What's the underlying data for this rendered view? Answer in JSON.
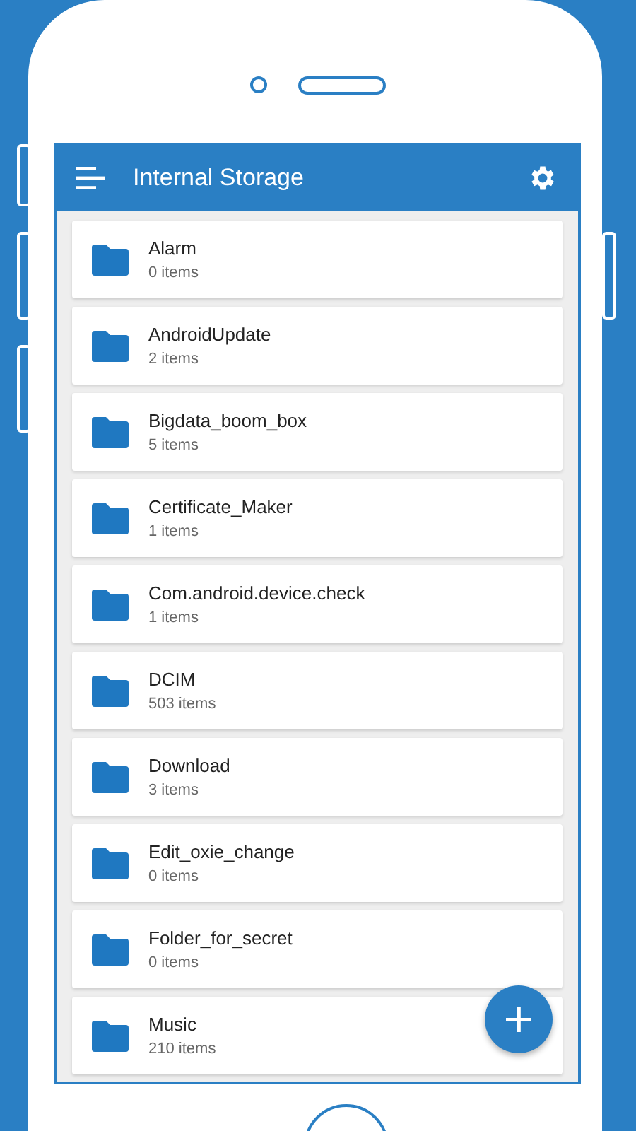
{
  "header": {
    "title": "Internal Storage"
  },
  "folders": [
    {
      "name": "Alarm",
      "count": "0 items"
    },
    {
      "name": "AndroidUpdate",
      "count": "2 items"
    },
    {
      "name": "Bigdata_boom_box",
      "count": "5 items"
    },
    {
      "name": "Certificate_Maker",
      "count": "1 items"
    },
    {
      "name": "Com.android.device.check",
      "count": "1 items"
    },
    {
      "name": "DCIM",
      "count": "503 items"
    },
    {
      "name": "Download",
      "count": "3 items"
    },
    {
      "name": "Edit_oxie_change",
      "count": "0 items"
    },
    {
      "name": "Folder_for_secret",
      "count": "0 items"
    },
    {
      "name": "Music",
      "count": "210 items"
    }
  ]
}
